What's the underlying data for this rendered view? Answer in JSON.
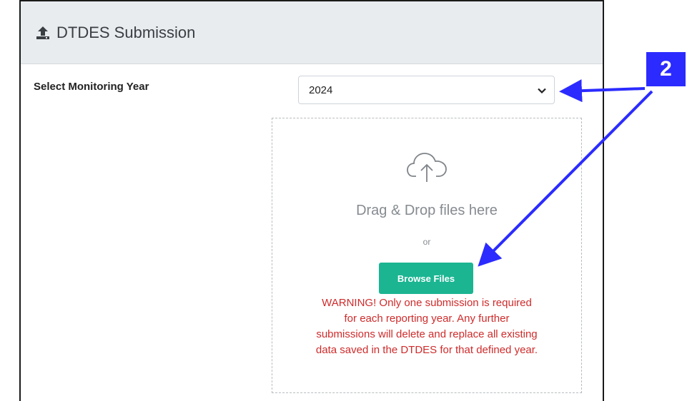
{
  "panel": {
    "title": "DTDES Submission",
    "title_icon": "upload-icon"
  },
  "monitoring_year": {
    "label": "Select Monitoring Year",
    "selected_value": "2024",
    "icon": "chevron-down-icon"
  },
  "dropzone": {
    "icon": "cloud-upload-icon",
    "drag_text": "Drag & Drop files here",
    "or_text": "or",
    "browse_label": "Browse Files",
    "warning_lines": [
      "WARNING! Only one submission is required",
      "for each reporting year. Any further",
      "submissions will delete and replace all existing",
      "data saved in the DTDES for that defined year."
    ]
  },
  "annotation": {
    "callout_number": "2"
  },
  "colors": {
    "header_bg": "#e9ecef",
    "browse_button": "#1bb592",
    "warning_text": "#cf2b2b",
    "annotation_blue": "#2b2bff"
  }
}
